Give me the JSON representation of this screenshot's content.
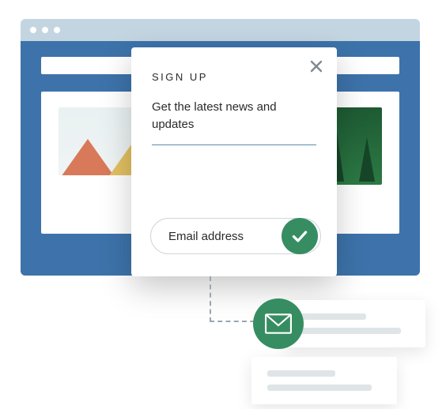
{
  "modal": {
    "title": "SIGN UP",
    "description": "Get the latest news and updates",
    "email_placeholder": "Email address"
  },
  "icons": {
    "close": "close-icon",
    "check": "check-icon",
    "mail": "mail-icon"
  },
  "colors": {
    "accent_green": "#378d62",
    "browser_blue": "#3d73aa",
    "chrome_light": "#c4d5e2"
  }
}
